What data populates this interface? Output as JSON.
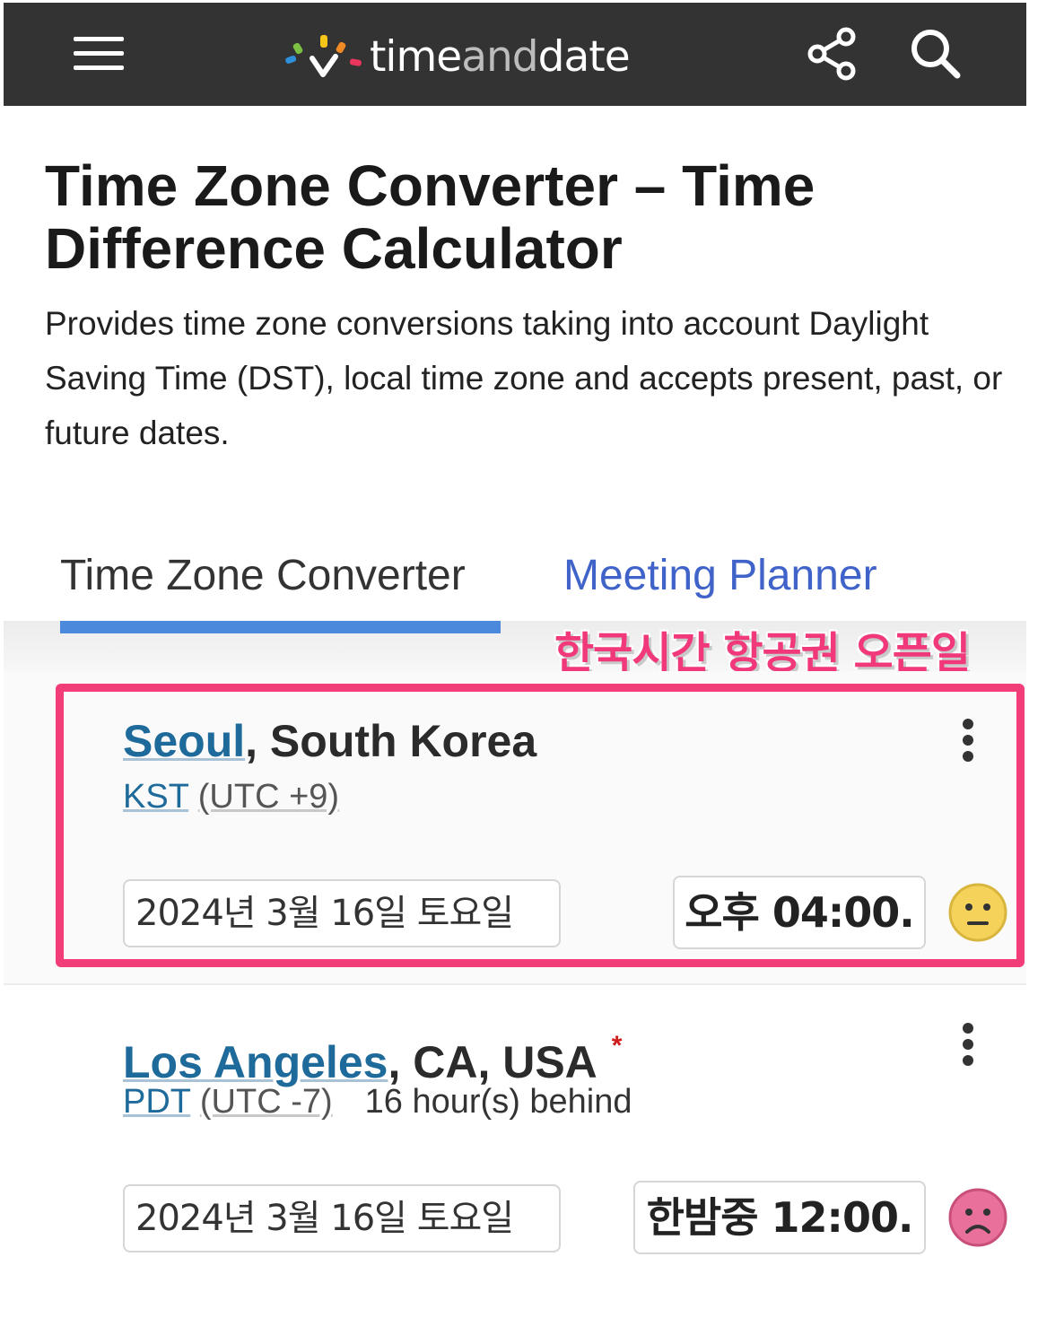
{
  "header": {
    "logo_text_time": "time",
    "logo_text_and": "and",
    "logo_text_date": "date",
    "menu_icon": "hamburger-menu-icon",
    "share_icon": "share-icon",
    "search_icon": "search-icon",
    "background_color": "#333333"
  },
  "page": {
    "title": "Time Zone Converter – Time Difference Calculator",
    "description": "Provides time zone conversions taking into account Daylight Saving Time (DST), local time zone and accepts present, past, or future dates."
  },
  "tabs": [
    {
      "label": "Time Zone Converter",
      "active": true
    },
    {
      "label": "Meeting Planner",
      "active": false
    }
  ],
  "overlay_caption": "한국시간 항공권 오픈일",
  "rows": [
    {
      "city": "Seoul",
      "region": ", South Korea",
      "tz_abbr": "KST",
      "tz_utc": "(UTC +9)",
      "relative": "",
      "date": "2024년 3월 16일 토요일",
      "time": "오후 04:00.",
      "mood_icon": "neutral-face-icon",
      "highlighted": true
    },
    {
      "city": "Los Angeles",
      "region": ", CA, USA",
      "dst_marker": "*",
      "tz_abbr": "PDT",
      "tz_utc": "(UTC -7)",
      "relative": "16 hour(s) behind",
      "date": "2024년 3월 16일 토요일",
      "time": "한밤중 12:00.",
      "mood_icon": "sad-face-icon",
      "highlighted": false
    }
  ],
  "colors": {
    "link": "#1e6a9a",
    "tab_active_underline": "#4a89dc",
    "tab_inactive": "#3f63c9",
    "highlight": "#f23d78"
  }
}
